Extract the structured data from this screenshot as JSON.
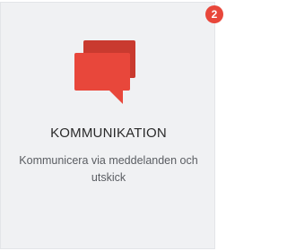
{
  "card": {
    "badge_count": "2",
    "icon": "chat-bubbles-icon",
    "title": "KOMMUNIKATION",
    "description": "Kommunicera via meddelanden och utskick"
  },
  "colors": {
    "accent": "#e8473b",
    "accent_dark": "#c93a2f",
    "card_background": "#f0f1f3",
    "title_text": "#2a2a2a",
    "description_text": "#5a5d62"
  }
}
